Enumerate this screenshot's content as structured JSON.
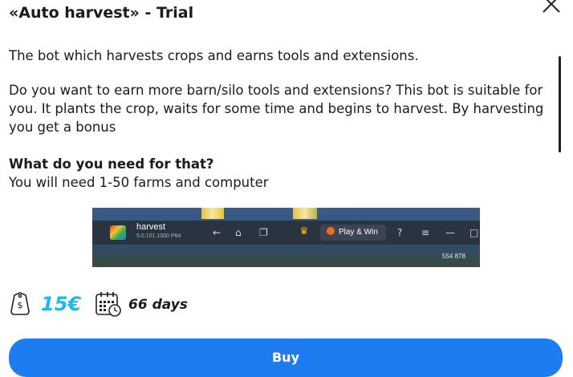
{
  "dialog": {
    "title": "«Auto harvest» - Trial",
    "close_icon": "close-icon"
  },
  "content": {
    "intro": "The bot which harvests crops and earns tools and extensions.",
    "desc_lines": [
      "Do you want to earn more barn/silo tools and extensions? This bot is suitable for",
      "you. It plants the crop, waits for some time and begins to harvest. By harvesting",
      "you get a bonus"
    ],
    "need_heading": "What do you need for that?",
    "need_text": "You will need 1-50 farms and computer"
  },
  "screenshot": {
    "app_name": "harvest",
    "app_version": "5.0.101.1000  P64",
    "play_label": "Play & Win",
    "coords": "554 878"
  },
  "offer": {
    "price": "15€",
    "duration": "66 days",
    "price_icon": "price-tag-icon",
    "calendar_icon": "calendar-clock-icon",
    "price_color": "#1fb8ec"
  },
  "actions": {
    "buy_label": "Buy",
    "buy_color": "#1d7cf2"
  }
}
